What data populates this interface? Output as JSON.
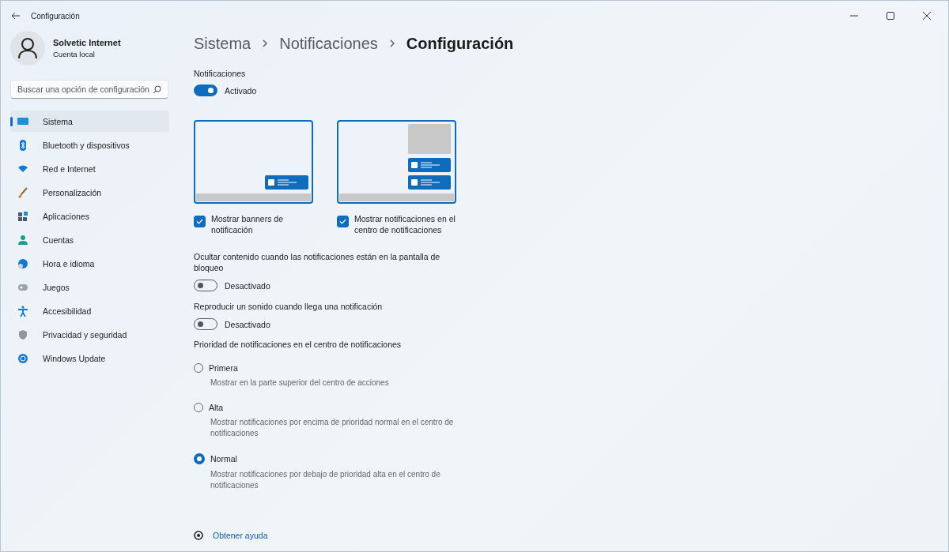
{
  "window": {
    "title": "Configuración"
  },
  "user": {
    "name": "Solvetic Internet",
    "account": "Cuenta local"
  },
  "search": {
    "placeholder": "Buscar una opción de configuración"
  },
  "sidebar": {
    "items": [
      {
        "label": "Sistema",
        "selected": true
      },
      {
        "label": "Bluetooth y dispositivos",
        "selected": false
      },
      {
        "label": "Red e Internet",
        "selected": false
      },
      {
        "label": "Personalización",
        "selected": false
      },
      {
        "label": "Aplicaciones",
        "selected": false
      },
      {
        "label": "Cuentas",
        "selected": false
      },
      {
        "label": "Hora e idioma",
        "selected": false
      },
      {
        "label": "Juegos",
        "selected": false
      },
      {
        "label": "Accesibilidad",
        "selected": false
      },
      {
        "label": "Privacidad y seguridad",
        "selected": false
      },
      {
        "label": "Windows Update",
        "selected": false
      }
    ]
  },
  "breadcrumb": [
    "Sistema",
    "Notificaciones",
    "Configuración"
  ],
  "notifications": {
    "label": "Notificaciones",
    "on": true,
    "state_text": "Activado"
  },
  "previews": [
    {
      "kind": "banner",
      "label": "Mostrar banners de notificación",
      "checked": true
    },
    {
      "kind": "center",
      "label": "Mostrar notificaciones en el centro de notificaciones",
      "checked": true
    }
  ],
  "toggles": [
    {
      "label": "Ocultar contenido cuando las notificaciones están en la pantalla de bloqueo",
      "on": false,
      "state_text": "Desactivado"
    },
    {
      "label": "Reproducir un sonido cuando llega una notificación",
      "on": false,
      "state_text": "Desactivado"
    }
  ],
  "priority": {
    "label": "Prioridad de notificaciones en el centro de notificaciones",
    "options": [
      {
        "label": "Primera",
        "description": "Mostrar en la parte superior del centro de acciones",
        "selected": false
      },
      {
        "label": "Alta",
        "description": "Mostrar notificaciones por encima de prioridad normal en el centro de notificaciones",
        "selected": false
      },
      {
        "label": "Normal",
        "description": "Mostrar notificaciones por debajo de prioridad alta en el centro de notificaciones",
        "selected": true
      }
    ]
  },
  "help_link": "Obtener ayuda"
}
